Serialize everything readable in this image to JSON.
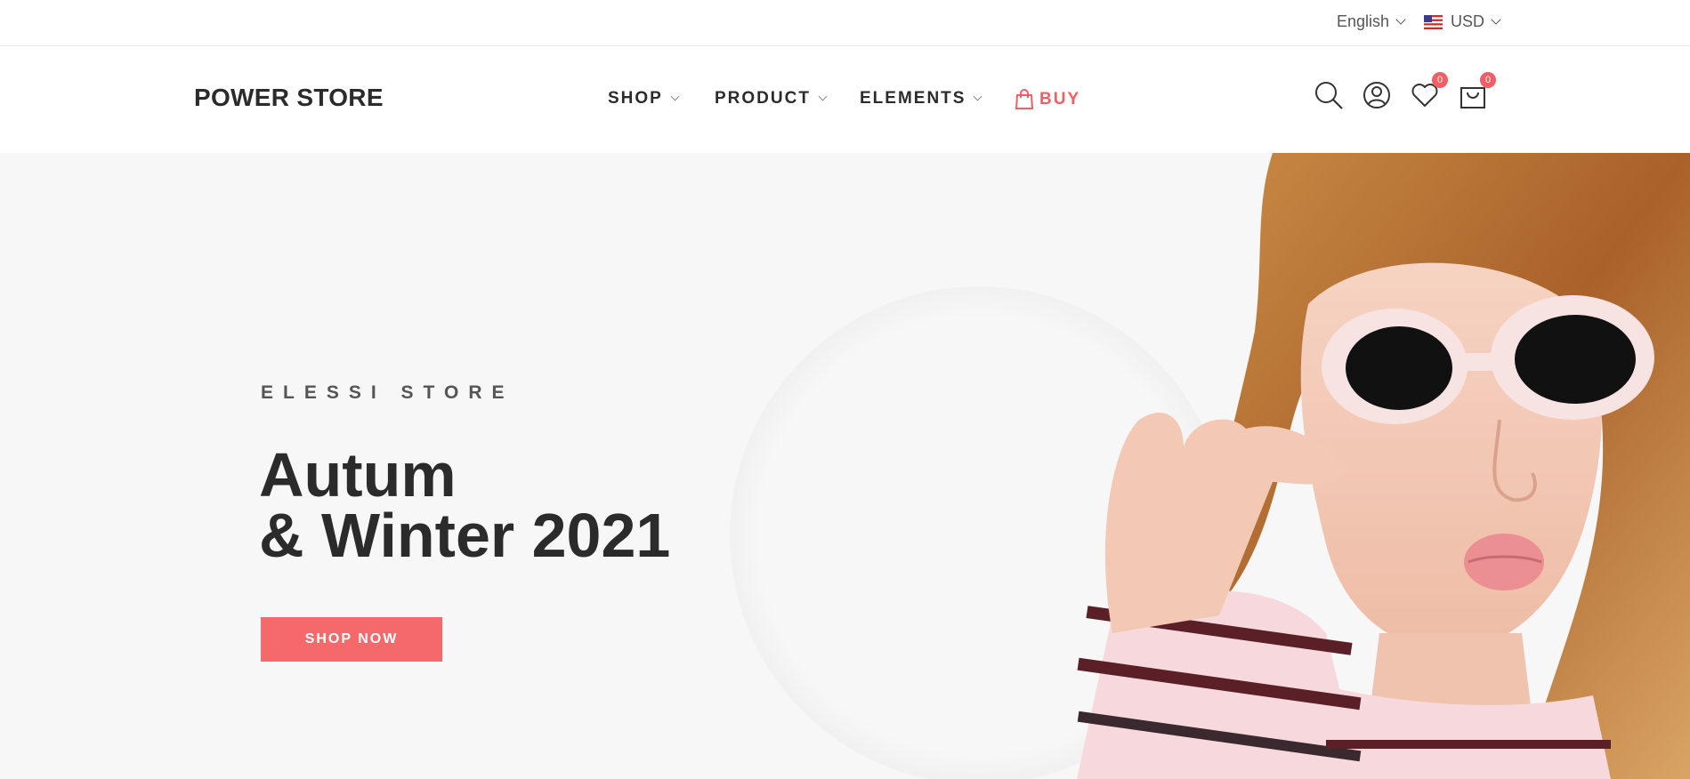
{
  "topbar": {
    "language": "English",
    "currency": "USD"
  },
  "header": {
    "logo": "POWER STORE",
    "nav": [
      {
        "label": "SHOP"
      },
      {
        "label": "PRODUCT"
      },
      {
        "label": "ELEMENTS"
      },
      {
        "label": "BUY"
      }
    ],
    "wishlist_count": "0",
    "cart_count": "0"
  },
  "hero": {
    "subtitle": "ELESSI STORE",
    "title_line1": "Autum",
    "title_line2": "& Winter 2021",
    "button": "SHOP NOW"
  },
  "colors": {
    "accent": "#f15f64",
    "button": "#f6696b",
    "hero_bg": "#f7f7f7",
    "text": "#2b2b2b"
  },
  "icons": [
    "chevron-down-icon",
    "us-flag-icon",
    "shopping-bag-icon",
    "search-icon",
    "user-icon",
    "heart-icon",
    "cart-icon"
  ]
}
